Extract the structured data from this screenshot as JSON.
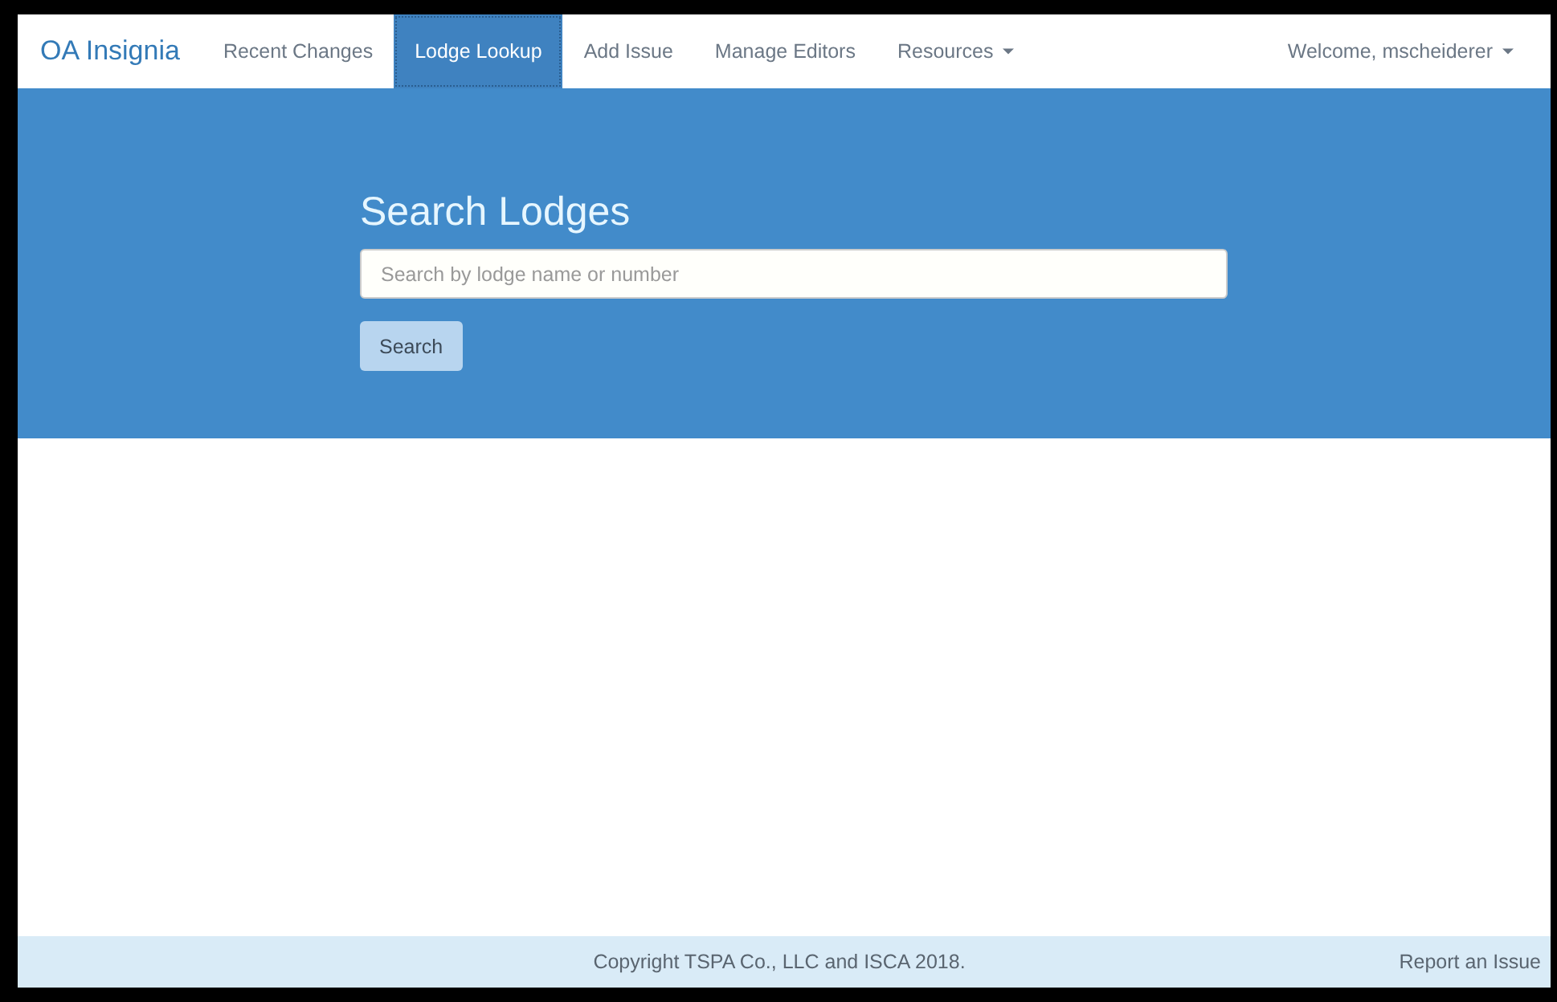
{
  "navbar": {
    "brand": "OA Insignia",
    "items": [
      {
        "label": "Recent Changes",
        "kind": "link",
        "selected": false
      },
      {
        "label": "Lodge Lookup",
        "kind": "link",
        "selected": true
      },
      {
        "label": "Add Issue",
        "kind": "link",
        "selected": false
      },
      {
        "label": "Manage Editors",
        "kind": "link",
        "selected": false
      },
      {
        "label": "Resources",
        "kind": "dropdown",
        "selected": false
      }
    ],
    "user_menu": {
      "label": "Welcome, mscheiderer",
      "kind": "dropdown"
    }
  },
  "hero": {
    "title": "Search Lodges",
    "search": {
      "placeholder": "Search by lodge name or number"
    },
    "button": "Search"
  },
  "footer": {
    "copyright": "Copyright TSPA Co., LLC and ISCA 2018.",
    "link": "Report an Issue"
  }
}
